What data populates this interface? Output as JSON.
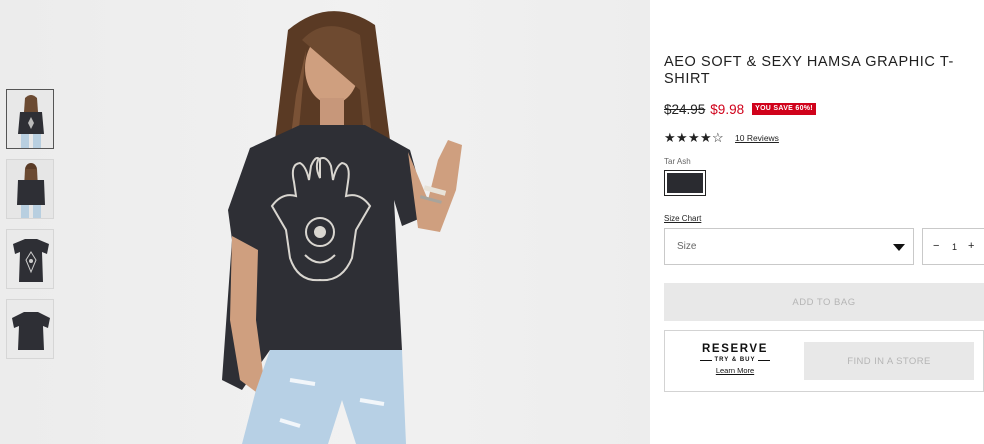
{
  "product": {
    "title": "AEO SOFT & SEXY HAMSA GRAPHIC T-SHIRT",
    "price_original": "$24.95",
    "price_sale": "$9.98",
    "save_badge": "YOU SAVE 60%!",
    "rating": {
      "stars_filled": 4,
      "stars_total": 5
    },
    "reviews_label": "10 Reviews",
    "color_name": "Tar Ash",
    "size_chart_label": "Size Chart",
    "size_placeholder": "Size",
    "quantity": "1",
    "qty_minus": "−",
    "qty_plus": "+",
    "add_to_bag_label": "ADD TO BAG"
  },
  "reserve": {
    "logo_word": "RESERVE",
    "logo_sub": "TRY & BUY",
    "learn_more": "Learn More",
    "find_store_label": "FIND IN A STORE"
  },
  "gallery": {
    "thumbnails": [
      "model-front",
      "model-back",
      "shirt-front",
      "shirt-back"
    ],
    "active_index": 0
  },
  "colors": {
    "sale_red": "#d0021b",
    "shirt": "#2e2f35",
    "disabled_button_bg": "#e8e8e8",
    "disabled_button_text": "#b5b5b5"
  },
  "icons": {
    "star_filled": "★",
    "star_empty": "☆",
    "caret": "chevron-down-icon"
  }
}
